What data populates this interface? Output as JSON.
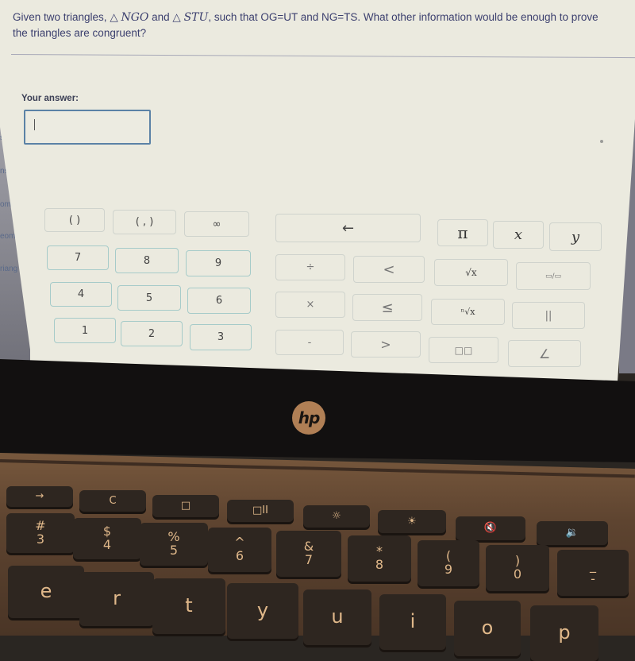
{
  "background_sidebar": {
    "partial_items": [
      "sf",
      "ns",
      "om",
      "eom",
      "riang"
    ]
  },
  "question": {
    "text_before_t1": "Given two triangles, ",
    "triangle_symbol": "△",
    "triangle1": "NGO",
    "and_text": " and ",
    "triangle2": "STU",
    "text_after": ", such that OG=UT and NG=TS. What other information would be enough to prove the triangles are congruent?"
  },
  "answer": {
    "label": "Your answer:",
    "value": "",
    "placeholder": ""
  },
  "keypad": {
    "left_block": [
      {
        "id": "parens",
        "label": "( )"
      },
      {
        "id": "interval",
        "label": "( , )"
      },
      {
        "id": "infinity",
        "label": "∞"
      },
      {
        "id": "7",
        "label": "7"
      },
      {
        "id": "8",
        "label": "8"
      },
      {
        "id": "9",
        "label": "9"
      },
      {
        "id": "4",
        "label": "4"
      },
      {
        "id": "5",
        "label": "5"
      },
      {
        "id": "6",
        "label": "6"
      },
      {
        "id": "1",
        "label": "1"
      },
      {
        "id": "2",
        "label": "2"
      },
      {
        "id": "3",
        "label": "3"
      }
    ],
    "middle_block": [
      {
        "id": "backspace",
        "label": "←"
      },
      {
        "id": "divide",
        "label": "÷"
      },
      {
        "id": "less-than",
        "label": "<"
      },
      {
        "id": "multiply",
        "label": "×"
      },
      {
        "id": "less-equal",
        "label": "≤"
      },
      {
        "id": "minus",
        "label": "-"
      },
      {
        "id": "greater-than",
        "label": ">"
      }
    ],
    "right_block": [
      {
        "id": "pi",
        "label": "π"
      },
      {
        "id": "x",
        "label": "x"
      },
      {
        "id": "y",
        "label": "y"
      },
      {
        "id": "sqrt",
        "label": "√x"
      },
      {
        "id": "fraction",
        "label": "▭/▭"
      },
      {
        "id": "nth-root",
        "label": "ⁿ√x"
      },
      {
        "id": "parallel",
        "label": "||"
      },
      {
        "id": "exponent",
        "label": "□□"
      },
      {
        "id": "angle",
        "label": "∠"
      }
    ]
  },
  "laptop": {
    "brand": "hp",
    "function_row": [
      {
        "id": "forward",
        "label": "→"
      },
      {
        "id": "refresh",
        "label": "C"
      },
      {
        "id": "fullscreen",
        "label": "□"
      },
      {
        "id": "overview",
        "label": "□II"
      },
      {
        "id": "brightness-down",
        "label": "☼"
      },
      {
        "id": "brightness-up",
        "label": "☀"
      },
      {
        "id": "mute",
        "label": "🔇"
      },
      {
        "id": "volume-down",
        "label": "🔉"
      }
    ],
    "number_row": [
      {
        "top": "#",
        "bottom": "3"
      },
      {
        "top": "$",
        "bottom": "4"
      },
      {
        "top": "%",
        "bottom": "5"
      },
      {
        "top": "^",
        "bottom": "6"
      },
      {
        "top": "&",
        "bottom": "7"
      },
      {
        "top": "*",
        "bottom": "8"
      },
      {
        "top": "(",
        "bottom": "9"
      },
      {
        "top": ")",
        "bottom": "0"
      },
      {
        "top": "_",
        "bottom": "-"
      }
    ],
    "letter_row": [
      "e",
      "r",
      "t",
      "y",
      "u",
      "i",
      "o",
      "p"
    ]
  }
}
